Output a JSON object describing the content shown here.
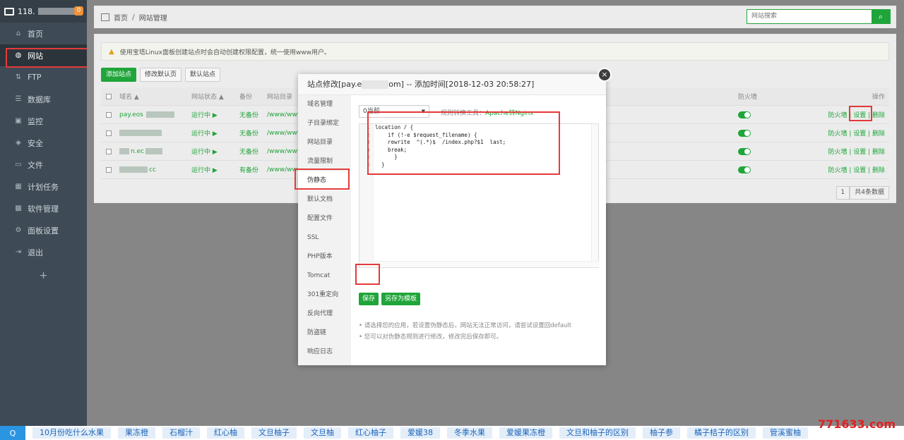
{
  "sidebar": {
    "host": "118.",
    "badge": "0",
    "items": [
      {
        "icon": "home-icon",
        "glyph": "⌂",
        "label": "首页"
      },
      {
        "icon": "globe-icon",
        "glyph": "◍",
        "label": "网站"
      },
      {
        "icon": "ftp-icon",
        "glyph": "⇅",
        "label": "FTP"
      },
      {
        "icon": "database-icon",
        "glyph": "☰",
        "label": "数据库"
      },
      {
        "icon": "monitor-icon",
        "glyph": "▣",
        "label": "监控"
      },
      {
        "icon": "shield-icon",
        "glyph": "◈",
        "label": "安全"
      },
      {
        "icon": "folder-icon",
        "glyph": "▭",
        "label": "文件"
      },
      {
        "icon": "calendar-icon",
        "glyph": "▦",
        "label": "计划任务"
      },
      {
        "icon": "apps-icon",
        "glyph": "▩",
        "label": "软件管理"
      },
      {
        "icon": "gear-icon",
        "glyph": "⚙",
        "label": "面板设置"
      },
      {
        "icon": "logout-icon",
        "glyph": "⇥",
        "label": "退出"
      }
    ],
    "plus": "+"
  },
  "topbar": {
    "home": "首页",
    "sep": "/",
    "current": "网站管理",
    "search_placeholder": "网站搜索"
  },
  "tip": "使用宝塔Linux面板创建站点时会自动创建权限配置，统一使用www用户。",
  "buttons": {
    "add": "添加站点",
    "modify_default": "修改默认页",
    "default_site": "默认站点"
  },
  "table": {
    "headers": {
      "name": "域名 ▲",
      "status": "网站状态 ▲",
      "backup": "备份",
      "dir": "网站目录",
      "fw": "防火墙",
      "ops": "操作"
    },
    "rows": [
      {
        "name": "pay.eos",
        "status": "运行中 ▶",
        "backup": "无备份",
        "dir": "/www/www",
        "ops": "防火墙 | 设置 | 删除"
      },
      {
        "name": "",
        "status": "运行中 ▶",
        "backup": "无备份",
        "dir": "/www/www",
        "ops": "防火墙 | 设置 | 删除"
      },
      {
        "name": "n.ec",
        "status": "运行中 ▶",
        "backup": "无备份",
        "dir": "/www/www",
        "ops": "防火墙 | 设置 | 删除"
      },
      {
        "name": "cc",
        "status": "运行中 ▶",
        "backup": "有备份",
        "dir": "/www/www",
        "ops": "防火墙 | 设置 | 删除"
      }
    ],
    "pager": {
      "page": "1",
      "total": "共4条数据"
    }
  },
  "modal": {
    "title_pre": "站点修改[pay.e",
    "title_post": "om] -- 添加时间[2018-12-03 20:58:27]",
    "close": "×",
    "tabs": [
      "域名管理",
      "子目录绑定",
      "网站目录",
      "流量限制",
      "伪静态",
      "默认文档",
      "配置文件",
      "SSL",
      "PHP版本",
      "Tomcat",
      "301重定向",
      "反向代理",
      "防盗链",
      "响应日志"
    ],
    "select": "0当前",
    "rule_tool_label": "规则转换工具：",
    "rule_tool_link": "Apache转Nginx",
    "code_lines": [
      "location / {",
      "    if (!-e $request_filename) {",
      "    rewrite  ^(.*)$  /index.php?$1  last;",
      "    break;",
      "      }",
      "  }"
    ],
    "line_numbers": [
      "1",
      "2",
      "3",
      "4",
      "5",
      "6"
    ],
    "save": "保存",
    "save_as": "另存为模板",
    "notes": [
      "请选择您的应用，若设置伪静态后，网站无法正常访问，请尝试设置回default",
      "您可以对伪静态规则进行修改，修改完后保存即可。"
    ]
  },
  "bottombar": {
    "logo": "Q",
    "keywords": [
      "10月份吃什么水果",
      "果冻橙",
      "石榴汁",
      "红心柚",
      "文旦柚子",
      "文旦柚",
      "红心柚子",
      "爱媛38",
      "冬季水果",
      "爱媛果冻橙",
      "文旦和柚子的区别",
      "柚子参",
      "橘子桔子的区别",
      "管溪蜜柚"
    ]
  },
  "watermark": "771633.com"
}
